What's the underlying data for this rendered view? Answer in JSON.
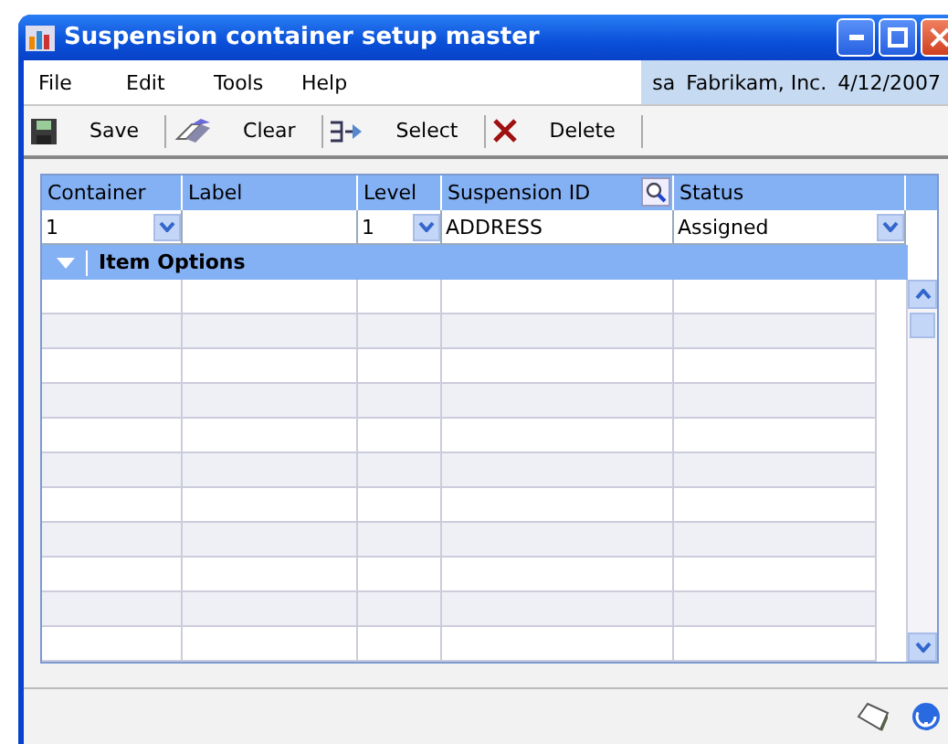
{
  "window": {
    "title": "Suspension container setup master"
  },
  "menu": [
    {
      "label": "File"
    },
    {
      "label": "Edit"
    },
    {
      "label": "Tools"
    },
    {
      "label": "Help"
    }
  ],
  "session": {
    "user": "sa",
    "company": "Fabrikam, Inc.",
    "date": "4/12/2007"
  },
  "toolbar": [
    {
      "kind": "save",
      "label": "Save"
    },
    {
      "kind": "clear",
      "label": "Clear"
    },
    {
      "kind": "select",
      "label": "Select"
    },
    {
      "kind": "delete",
      "label": "Delete"
    }
  ],
  "table": {
    "columns": [
      {
        "label": "Container",
        "lookup": false
      },
      {
        "label": "Label",
        "lookup": false
      },
      {
        "label": "Level",
        "lookup": false
      },
      {
        "label": "Suspension ID",
        "lookup": true
      },
      {
        "label": "Status",
        "lookup": false
      }
    ],
    "entry": [
      {
        "value": "1",
        "dropdown": true
      },
      {
        "dropdown": false
      },
      {
        "value": "1",
        "dropdown": true
      },
      {
        "value": "ADDRESS",
        "dropdown": false
      },
      {
        "value": "Assigned",
        "dropdown": true
      }
    ],
    "section": {
      "label": "Item Options",
      "expanded": true
    }
  }
}
